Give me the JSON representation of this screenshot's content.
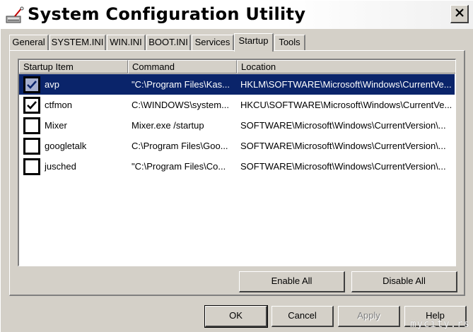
{
  "window": {
    "title": "System Configuration Utility"
  },
  "tabs": [
    {
      "label": "General"
    },
    {
      "label": "SYSTEM.INI"
    },
    {
      "label": "WIN.INI"
    },
    {
      "label": "BOOT.INI"
    },
    {
      "label": "Services"
    },
    {
      "label": "Startup",
      "active": true
    },
    {
      "label": "Tools"
    }
  ],
  "startup": {
    "columns": [
      "Startup Item",
      "Command",
      "Location"
    ],
    "rows": [
      {
        "checked": true,
        "selected": true,
        "item": "avp",
        "command": "\"C:\\Program Files\\Kas...",
        "location": "HKLM\\SOFTWARE\\Microsoft\\Windows\\CurrentVe..."
      },
      {
        "checked": true,
        "selected": false,
        "item": "ctfmon",
        "command": "C:\\WINDOWS\\system...",
        "location": "HKCU\\SOFTWARE\\Microsoft\\Windows\\CurrentVe..."
      },
      {
        "checked": false,
        "selected": false,
        "item": "Mixer",
        "command": "Mixer.exe /startup",
        "location": "SOFTWARE\\Microsoft\\Windows\\CurrentVersion\\..."
      },
      {
        "checked": false,
        "selected": false,
        "item": "googletalk",
        "command": "C:\\Program Files\\Goo...",
        "location": "SOFTWARE\\Microsoft\\Windows\\CurrentVersion\\..."
      },
      {
        "checked": false,
        "selected": false,
        "item": "jusched",
        "command": "\"C:\\Program Files\\Co...",
        "location": "SOFTWARE\\Microsoft\\Windows\\CurrentVersion\\..."
      }
    ],
    "enable_all_label": "Enable All",
    "disable_all_label": "Disable All"
  },
  "footer": {
    "ok_label": "OK",
    "cancel_label": "Cancel",
    "apply_label": "Apply",
    "apply_disabled": true,
    "help_label": "Help"
  },
  "watermark": "mycity.rs",
  "colors": {
    "selection": "#0a246a",
    "face": "#d4d0c8"
  }
}
